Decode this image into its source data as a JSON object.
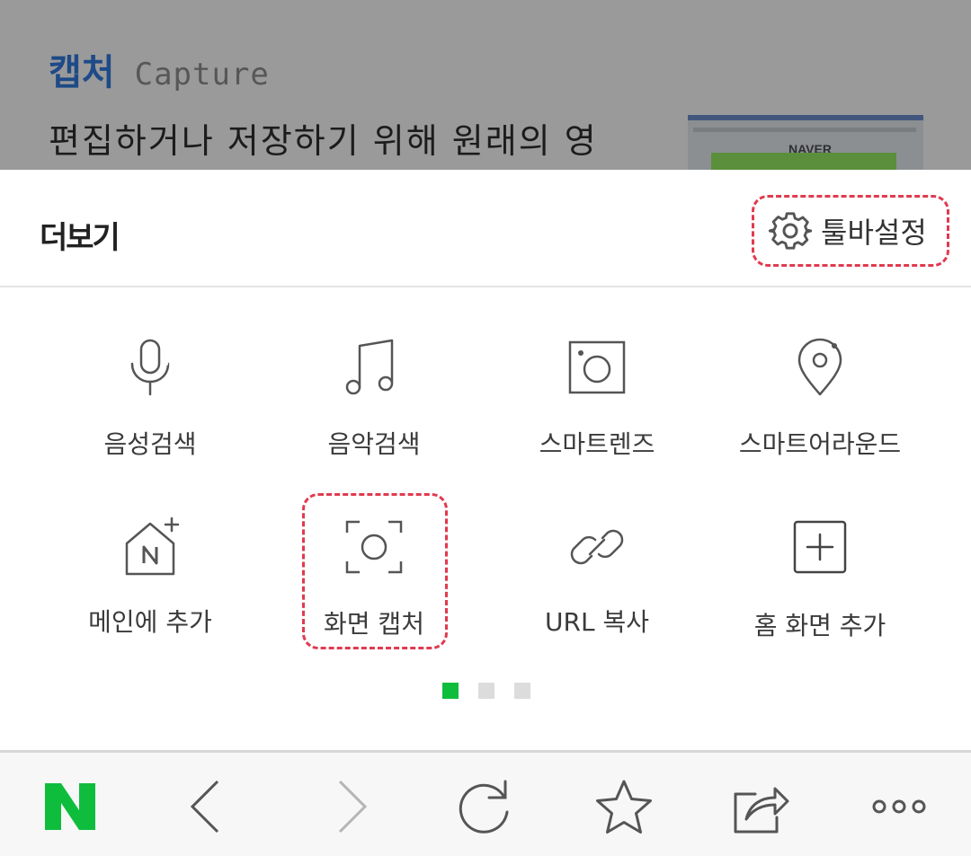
{
  "background": {
    "title_ko": "캡처",
    "title_en": "Capture",
    "text": "편집하거나 저장하기 위해 원래의 영",
    "thumb_logo": "NAVER"
  },
  "sheet": {
    "title": "더보기",
    "settings_label": "툴바설정",
    "settings_icon": "gear-icon"
  },
  "grid": {
    "items": [
      {
        "label": "음성검색",
        "icon": "microphone-icon"
      },
      {
        "label": "음악검색",
        "icon": "music-note-icon"
      },
      {
        "label": "스마트렌즈",
        "icon": "camera-lens-icon"
      },
      {
        "label": "스마트어라운드",
        "icon": "location-pin-icon"
      },
      {
        "label": "메인에 추가",
        "icon": "add-to-main-icon"
      },
      {
        "label": "화면 캡처",
        "icon": "screen-capture-icon"
      },
      {
        "label": "URL 복사",
        "icon": "link-icon"
      },
      {
        "label": "홈 화면 추가",
        "icon": "plus-square-icon"
      }
    ]
  },
  "pagination": {
    "pages": 3,
    "current": 1
  },
  "bottom_bar": {
    "items": [
      "naver-logo-icon",
      "back-icon",
      "forward-icon",
      "refresh-icon",
      "star-icon",
      "share-icon",
      "more-icon"
    ],
    "logo_text": "N"
  },
  "colors": {
    "accent_green": "#0fbd3d",
    "highlight_red": "#e03a4f",
    "backdrop_gray": "#9a9a9a",
    "title_blue": "#1e4a87"
  }
}
